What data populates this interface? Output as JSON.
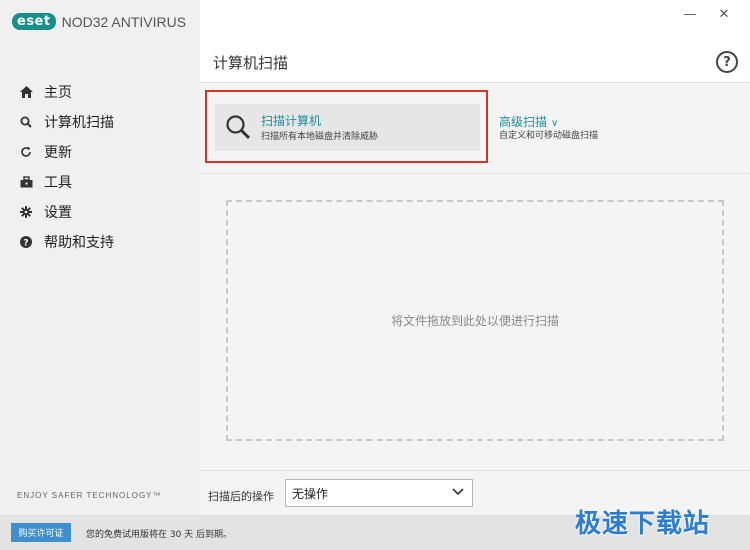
{
  "app": {
    "logo": "eset",
    "product_name": "NOD32 ANTIVIRUS"
  },
  "window_controls": {
    "minimize": "—",
    "close": "✕"
  },
  "sidebar": {
    "items": [
      {
        "label": "主页",
        "icon": "home-icon"
      },
      {
        "label": "计算机扫描",
        "icon": "search-icon"
      },
      {
        "label": "更新",
        "icon": "refresh-icon"
      },
      {
        "label": "工具",
        "icon": "toolbox-icon"
      },
      {
        "label": "设置",
        "icon": "gear-icon"
      },
      {
        "label": "帮助和支持",
        "icon": "help-icon"
      }
    ],
    "tagline": "ENJOY SAFER TECHNOLOGY™"
  },
  "header": {
    "title": "计算机扫描",
    "help": "?"
  },
  "scan": {
    "title": "扫描计算机",
    "subtitle": "扫描所有本地磁盘并清除威胁"
  },
  "advanced": {
    "title": "高级扫描",
    "chevron": "∨",
    "subtitle": "自定义和可移动磁盘扫描"
  },
  "drop_zone": {
    "text": "将文件拖放到此处以便进行扫描"
  },
  "after_scan": {
    "label": "扫描后的操作",
    "value": "无操作"
  },
  "status": {
    "buy_label": "购买许可证",
    "trial_text": "您的免费试用版将在 30 天 后到期。"
  },
  "watermark": "极速下载站",
  "colors": {
    "accent": "#1a8fa0",
    "brand": "#178f8d",
    "highlight": "#d0342c",
    "buy": "#3f8fcf"
  }
}
